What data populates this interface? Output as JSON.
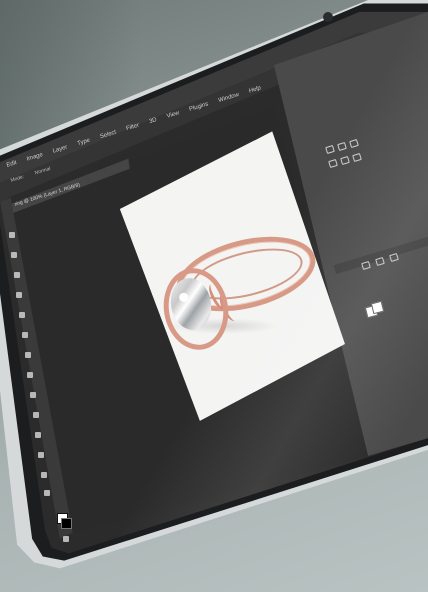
{
  "app": {
    "menu": [
      "Edit",
      "Image",
      "Layer",
      "Type",
      "Select",
      "Filter",
      "3D",
      "View",
      "Plugins",
      "Window",
      "Help"
    ],
    "options": [
      "Mode:",
      "Normal"
    ],
    "document_tab": "ring @ 100% (Layer 1, RGB/8)"
  },
  "canvas": {
    "subject": "rose gold ring with diamond",
    "background_color": "#f4f4f3"
  },
  "colors": {
    "ui_dark": "#2b2b2b",
    "panel": "#4a4a4a",
    "rose_gold": "#d79a86"
  },
  "icons": {
    "tools": [
      "move-tool-icon",
      "marquee-tool-icon",
      "lasso-tool-icon",
      "crop-tool-icon",
      "eyedropper-tool-icon",
      "brush-tool-icon",
      "stamp-tool-icon",
      "eraser-tool-icon",
      "gradient-tool-icon",
      "pen-tool-icon",
      "type-tool-icon",
      "path-select-icon",
      "shape-tool-icon",
      "hand-tool-icon",
      "zoom-tool-icon"
    ],
    "panels": [
      "adjustment-icon",
      "layers-icon",
      "brightness-icon",
      "curves-icon",
      "levels-icon",
      "hue-icon"
    ]
  }
}
